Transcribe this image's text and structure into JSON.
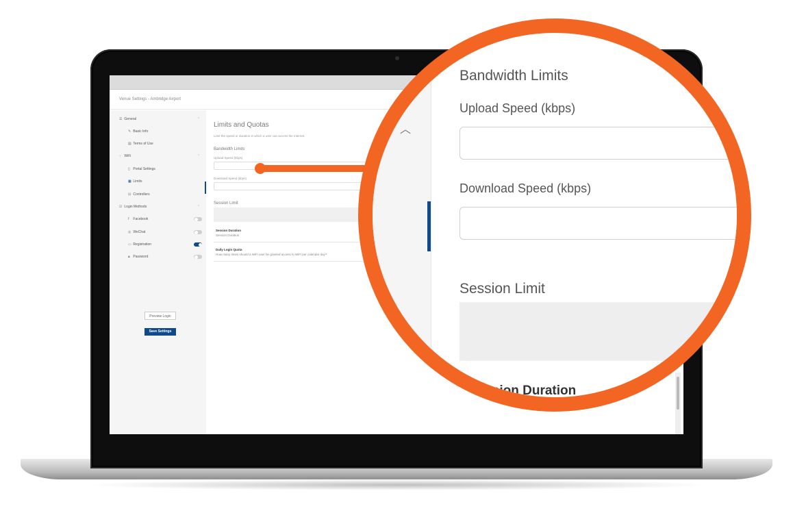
{
  "window": {
    "page_title": "Venue Settings - Ambridge Airport"
  },
  "sidebar": {
    "sections": [
      {
        "label": "General",
        "icon": "list-icon",
        "items": [
          {
            "label": "Basic Info",
            "icon": "pencil-icon"
          },
          {
            "label": "Terms of Use",
            "icon": "document-icon"
          }
        ]
      },
      {
        "label": "WiFi",
        "icon": "wifi-icon",
        "items": [
          {
            "label": "Portal Settings",
            "icon": "page-icon"
          },
          {
            "label": "Limits",
            "icon": "limits-icon"
          },
          {
            "label": "Controllers",
            "icon": "controller-icon"
          }
        ]
      },
      {
        "label": "Login Methods",
        "icon": "login-icon",
        "items": [
          {
            "label": "Facebook",
            "icon": "facebook-icon",
            "enabled": false
          },
          {
            "label": "WeChat",
            "icon": "wechat-icon",
            "enabled": false
          },
          {
            "label": "Registration",
            "icon": "registration-icon",
            "enabled": true
          },
          {
            "label": "Password",
            "icon": "lock-icon",
            "enabled": false
          }
        ]
      }
    ],
    "preview_label": "Preview Login",
    "save_label": "Save Settings"
  },
  "content": {
    "title": "Limits and Quotas",
    "description": "Limit the speed or duration in which a user can access the internet.",
    "bandwidth_title": "Bandwidth Limits",
    "upload_label": "Upload Speed (kbps)",
    "download_label": "Download Speed (kbps)",
    "session_title": "Session Limit",
    "rows": [
      {
        "title": "Session Duration",
        "subtitle": "Session Duration"
      },
      {
        "title": "Daily Login Quota",
        "subtitle": "How many times should a WiFi user be granted access to WiFi per calendar day?"
      }
    ]
  },
  "magnifier": {
    "bandwidth_title": "Bandwidth Limits",
    "upload_label": "Upload Speed (kbps)",
    "download_label": "Download Speed (kbps)",
    "session_title": "Session Limit",
    "session_duration": "Session Duration",
    "partial_text": "... should..."
  },
  "colors": {
    "accent": "#0e4a8c",
    "highlight": "#f26522"
  }
}
